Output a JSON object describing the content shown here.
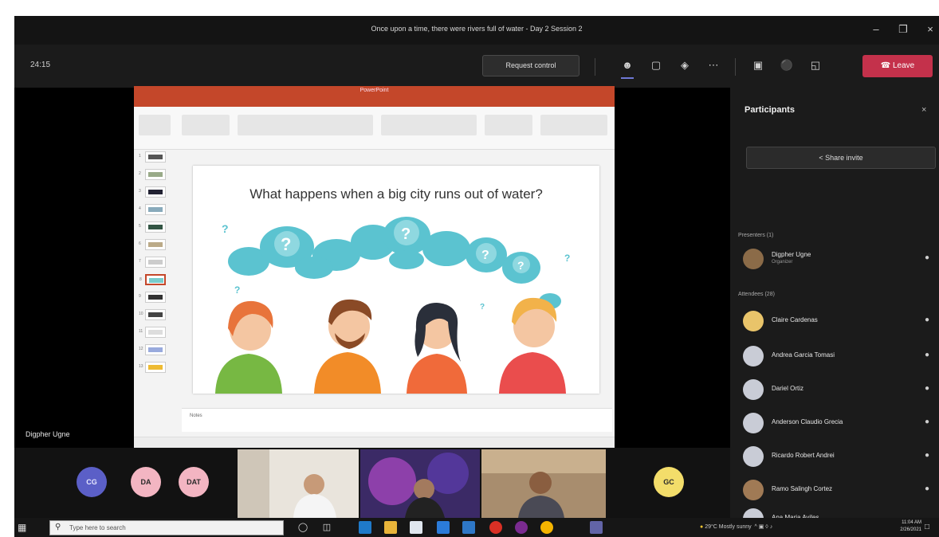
{
  "window": {
    "title": "Once upon a time, there were rivers full of water - Day 2 Session 2"
  },
  "toolbar": {
    "timer": "24:15",
    "request_control_label": "Request control",
    "leave_label": "Leave"
  },
  "presentation": {
    "presenter_name": "Digpher Ugne",
    "app_title": "PowerPoint",
    "slide_title": "What happens when a big city runs out of water?",
    "notes_label": "Notes"
  },
  "participants": {
    "title": "Participants",
    "share_invite_label": "Share invite",
    "presenters_heading": "Presenters (1)",
    "attendees_heading": "Attendees (28)",
    "presenters": [
      {
        "name": "Digpher Ugne",
        "role": "Organizer"
      }
    ],
    "attendees": [
      {
        "name": "Claire Cardenas"
      },
      {
        "name": "Andrea Garcia Tomasi"
      },
      {
        "name": "Dariel Ortiz"
      },
      {
        "name": "Anderson Claudio Grecia"
      },
      {
        "name": "Ricardo Robert Andrei"
      },
      {
        "name": "Ramo Salingh Cortez"
      },
      {
        "name": "Ana Maria Aviles"
      }
    ]
  },
  "gallery": {
    "initials": [
      "CG",
      "DA",
      "DAT",
      "GC"
    ]
  },
  "taskbar": {
    "search_placeholder": "Type here to search",
    "tray_text": "29°C Mostly sunny",
    "time": "11:04 AM",
    "date": "2/26/2021"
  }
}
